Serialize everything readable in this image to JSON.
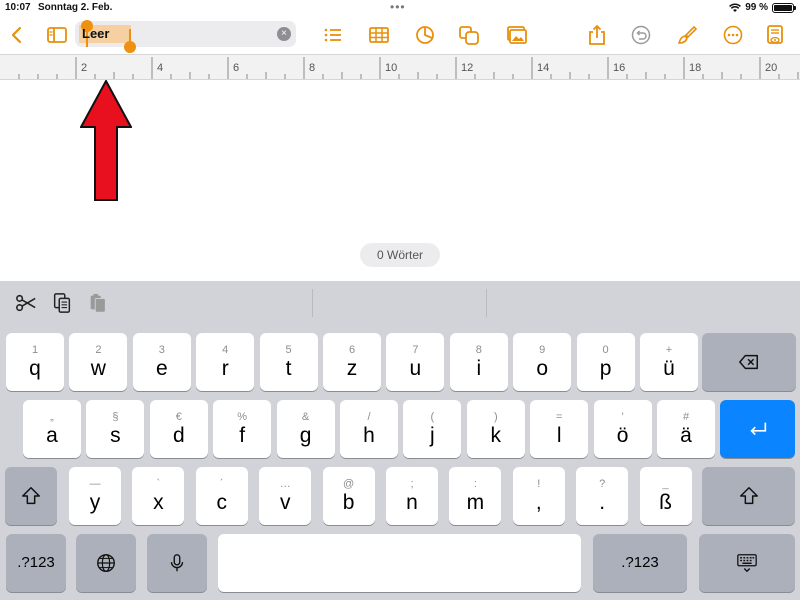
{
  "status": {
    "time": "10:07",
    "date": "Sonntag 2. Feb.",
    "battery": "99 %",
    "battery_level": 0.99
  },
  "toolbar": {
    "title_value": "Leer",
    "clear_glyph": "×",
    "icons": [
      "chevron-left-icon",
      "sidebar-icon",
      "list-icon",
      "table-icon",
      "chart-icon",
      "shapes-icon",
      "media-icon",
      "share-icon",
      "undo-icon",
      "paintbrush-icon",
      "more-icon",
      "document-icon"
    ]
  },
  "ruler": {
    "labels": [
      "2",
      "4",
      "6",
      "8",
      "10",
      "12",
      "14",
      "16",
      "18",
      "20"
    ]
  },
  "document": {
    "word_count": "0 Wörter"
  },
  "colors": {
    "accent": "#e8900c",
    "selection": "#f6d0a0",
    "arrow": "#e8101e",
    "return_key": "#0a84ff",
    "keyboard_bg": "#d1d3d9"
  },
  "keyboard": {
    "row1": [
      {
        "hint": "1",
        "label": "q"
      },
      {
        "hint": "2",
        "label": "w"
      },
      {
        "hint": "3",
        "label": "e"
      },
      {
        "hint": "4",
        "label": "r"
      },
      {
        "hint": "5",
        "label": "t"
      },
      {
        "hint": "6",
        "label": "z"
      },
      {
        "hint": "7",
        "label": "u"
      },
      {
        "hint": "8",
        "label": "i"
      },
      {
        "hint": "9",
        "label": "o"
      },
      {
        "hint": "0",
        "label": "p"
      },
      {
        "hint": "+",
        "label": "ü"
      }
    ],
    "row2": [
      {
        "hint": "„",
        "label": "a"
      },
      {
        "hint": "§",
        "label": "s"
      },
      {
        "hint": "€",
        "label": "d"
      },
      {
        "hint": "%",
        "label": "f"
      },
      {
        "hint": "&",
        "label": "g"
      },
      {
        "hint": "/",
        "label": "h"
      },
      {
        "hint": "(",
        "label": "j"
      },
      {
        "hint": ")",
        "label": "k"
      },
      {
        "hint": "=",
        "label": "l"
      },
      {
        "hint": "’",
        "label": "ö"
      },
      {
        "hint": "#",
        "label": "ä"
      }
    ],
    "row3": [
      {
        "hint": "—",
        "label": "y"
      },
      {
        "hint": "`",
        "label": "x"
      },
      {
        "hint": "´",
        "label": "c"
      },
      {
        "hint": "…",
        "label": "v"
      },
      {
        "hint": "@",
        "label": "b"
      },
      {
        "hint": ";",
        "label": "n"
      },
      {
        "hint": ":",
        "label": "m"
      },
      {
        "hint": "!",
        "label": ","
      },
      {
        "hint": "?",
        "label": "."
      },
      {
        "hint": "_",
        "label": "ß"
      }
    ],
    "numbers_label": ".?123"
  }
}
